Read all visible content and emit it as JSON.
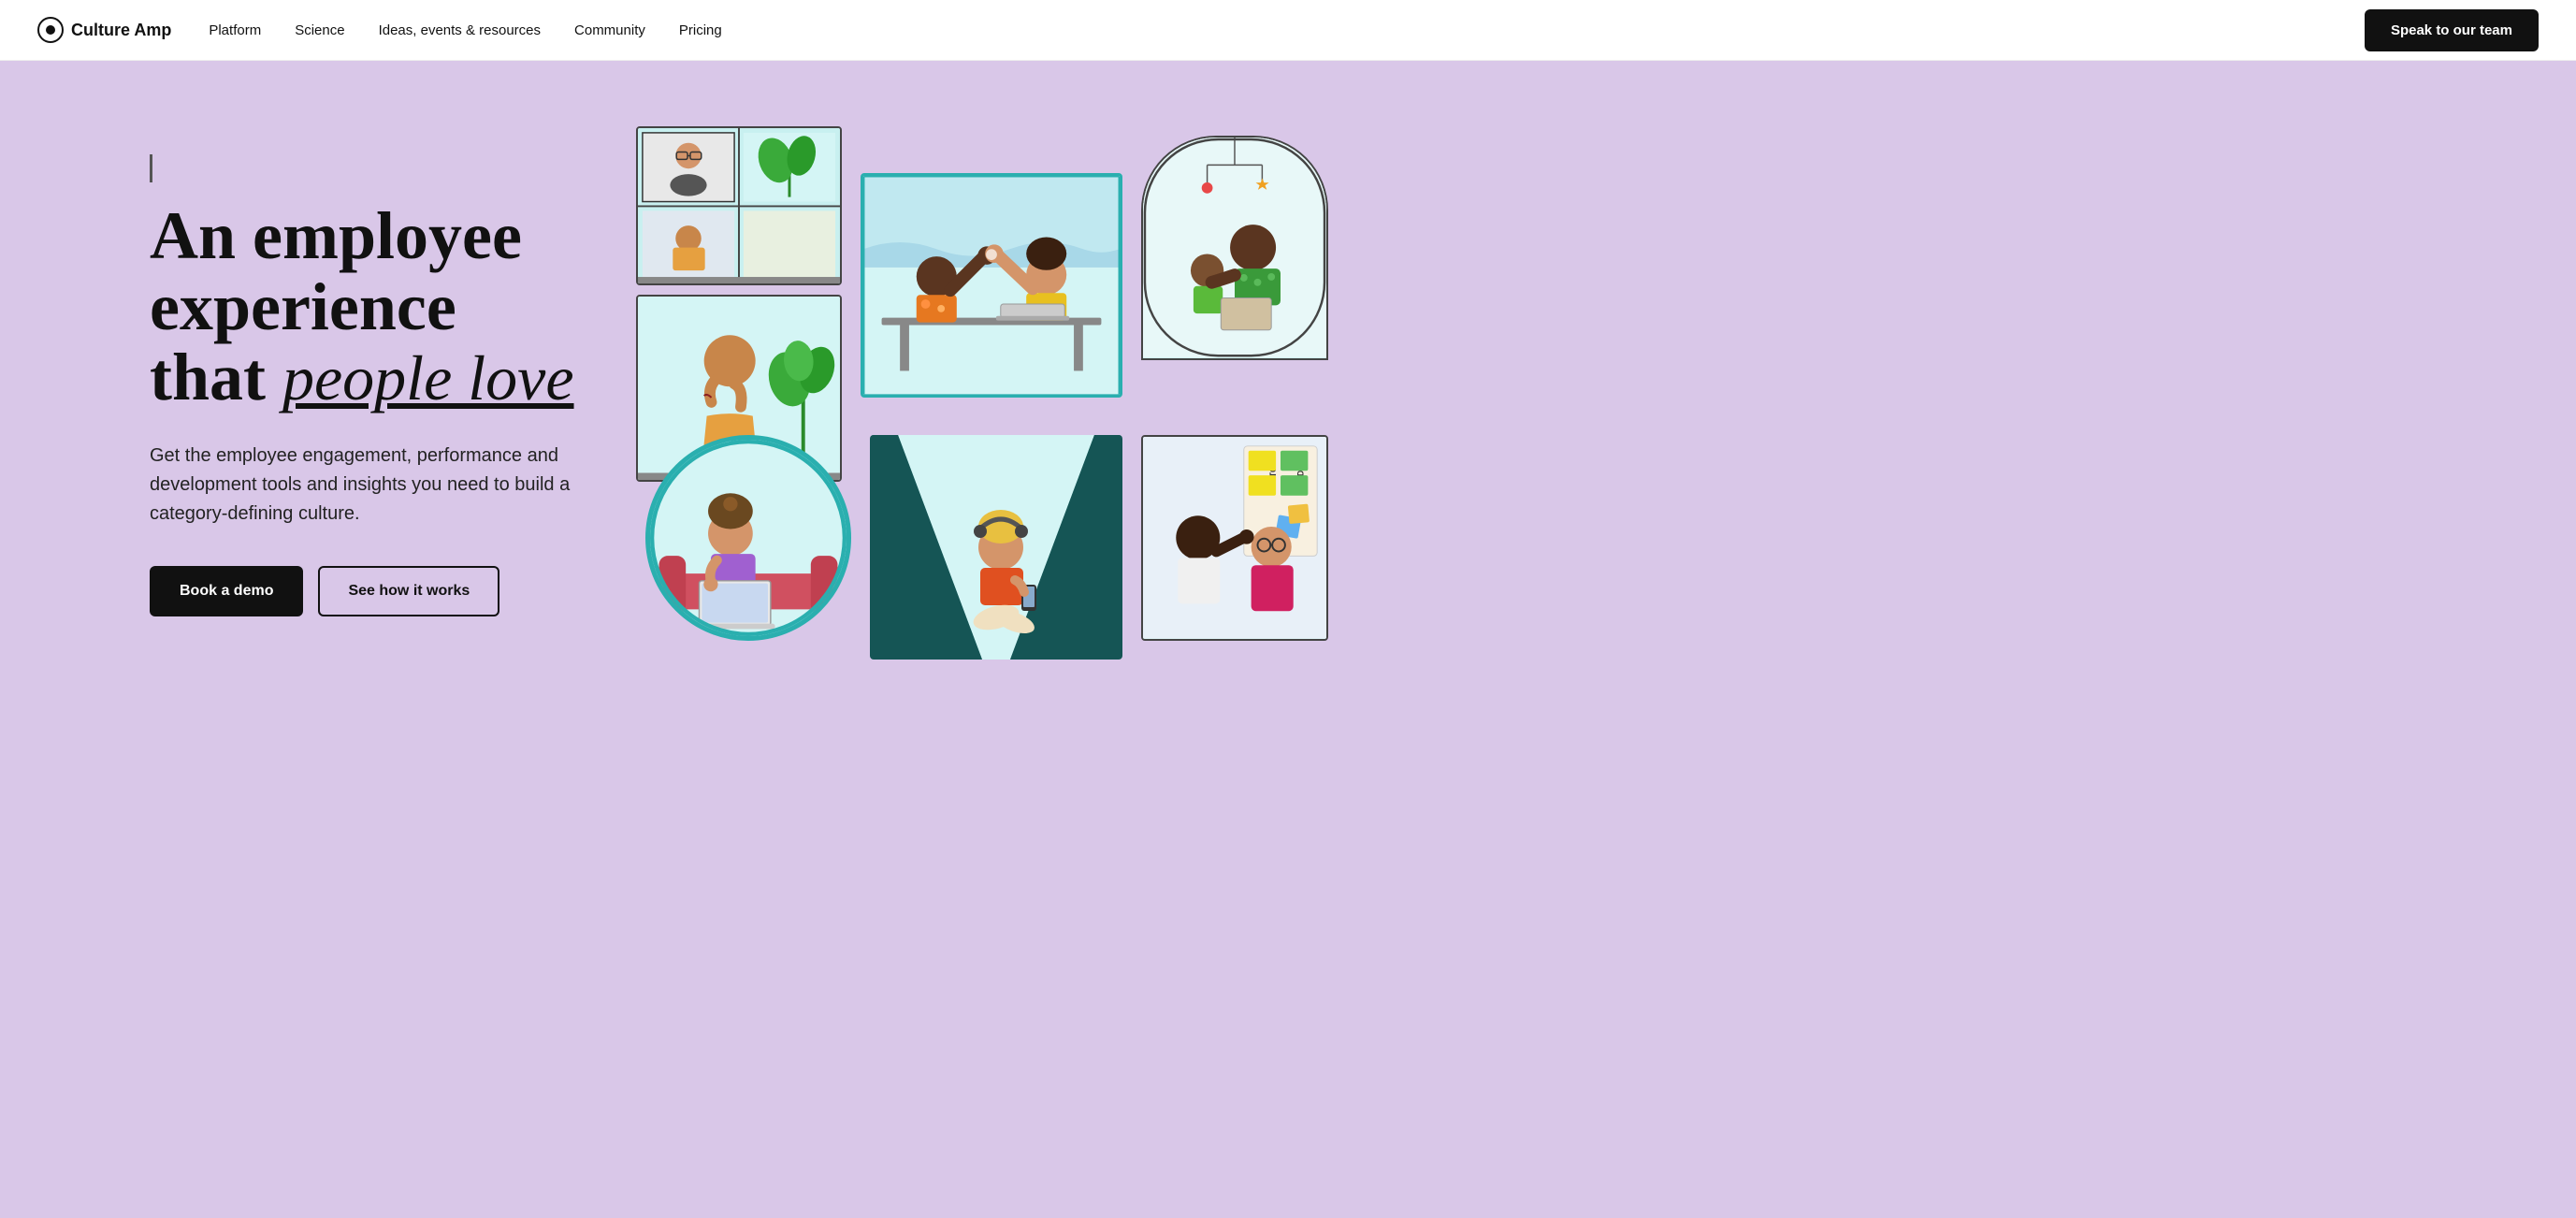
{
  "nav": {
    "logo_text": "Culture Amp",
    "links": [
      {
        "id": "platform",
        "label": "Platform"
      },
      {
        "id": "science",
        "label": "Science"
      },
      {
        "id": "ideas",
        "label": "Ideas, events & resources"
      },
      {
        "id": "community",
        "label": "Community"
      },
      {
        "id": "pricing",
        "label": "Pricing"
      }
    ],
    "cta_label": "Speak to our team"
  },
  "hero": {
    "heading_line1": "An employee",
    "heading_line2": "experience",
    "heading_line3_normal": "that ",
    "heading_line3_italic": "people love",
    "subtext": "Get the employee engagement, performance and development tools and insights you need to build a category-defining culture.",
    "btn_primary": "Book a demo",
    "btn_secondary": "See how it works"
  }
}
